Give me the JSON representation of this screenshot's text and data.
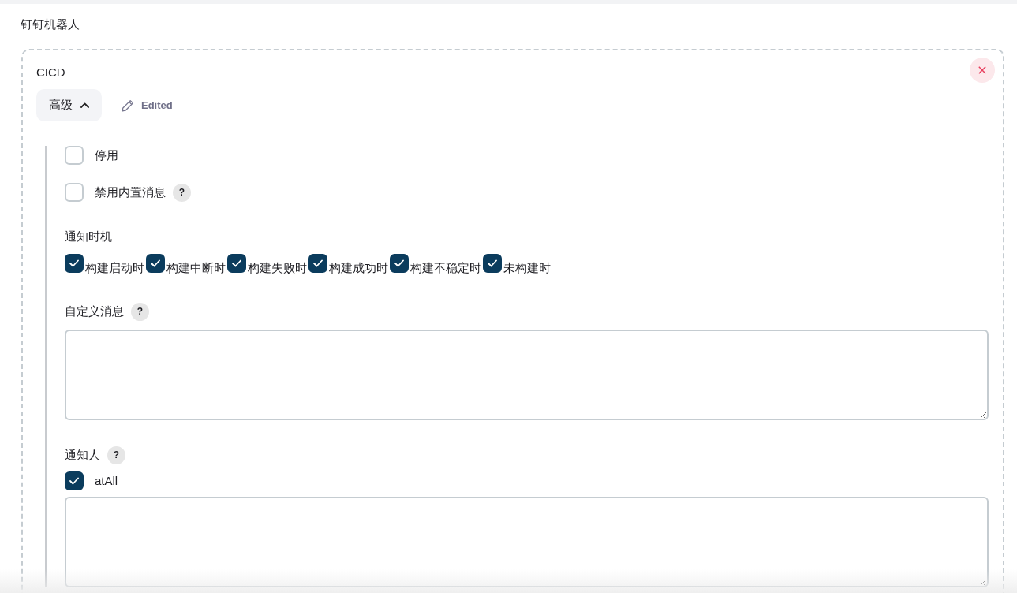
{
  "section_title": "钉钉机器人",
  "robot": {
    "name": "CICD",
    "advanced_button": {
      "label": "高级",
      "expanded": true
    },
    "edited_label": "Edited",
    "options": [
      {
        "label": "停用",
        "checked": false
      },
      {
        "label": "禁用内置消息",
        "checked": false,
        "help": "?"
      }
    ],
    "notify_timing": {
      "label": "通知时机",
      "options": [
        {
          "label": "构建启动时",
          "checked": true
        },
        {
          "label": "构建中断时",
          "checked": true
        },
        {
          "label": "构建失败时",
          "checked": true
        },
        {
          "label": "构建成功时",
          "checked": true
        },
        {
          "label": "构建不稳定时",
          "checked": true
        },
        {
          "label": "未构建时",
          "checked": true
        }
      ]
    },
    "custom_message": {
      "label": "自定义消息",
      "help": "?"
    },
    "recipients": {
      "label": "通知人",
      "help": "?",
      "at_all": {
        "label": "atAll",
        "checked": true
      }
    }
  }
}
